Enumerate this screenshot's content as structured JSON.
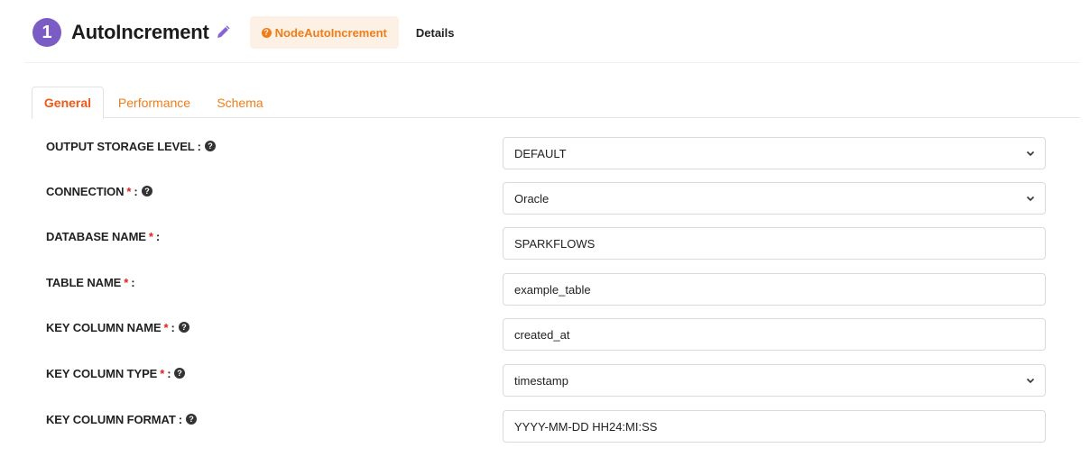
{
  "header": {
    "step_number": "1",
    "title": "AutoIncrement",
    "node_type": "NodeAutoIncrement",
    "details_label": "Details"
  },
  "tabs": [
    {
      "label": "General",
      "active": true
    },
    {
      "label": "Performance",
      "active": false
    },
    {
      "label": "Schema",
      "active": false
    }
  ],
  "fields": {
    "output_storage_level": {
      "label": "OUTPUT STORAGE LEVEL",
      "required": false,
      "help": true,
      "type": "select",
      "value": "DEFAULT"
    },
    "connection": {
      "label": "CONNECTION",
      "required": true,
      "help": true,
      "type": "select",
      "value": "Oracle"
    },
    "database_name": {
      "label": "DATABASE NAME",
      "required": true,
      "help": false,
      "type": "text",
      "value": "SPARKFLOWS"
    },
    "table_name": {
      "label": "TABLE NAME",
      "required": true,
      "help": false,
      "type": "text",
      "value": "example_table"
    },
    "key_column_name": {
      "label": "KEY COLUMN NAME",
      "required": true,
      "help": true,
      "type": "text",
      "value": "created_at"
    },
    "key_column_type": {
      "label": "KEY COLUMN TYPE",
      "required": true,
      "help": true,
      "type": "select",
      "value": "timestamp"
    },
    "key_column_format": {
      "label": "KEY COLUMN FORMAT",
      "required": false,
      "help": true,
      "type": "text",
      "value": "YYYY-MM-DD HH24:MI:SS"
    }
  },
  "symbols": {
    "required_mark": "*",
    "colon": ":"
  },
  "icons": {
    "edit": "pencil-icon",
    "help": "question-circle-icon",
    "badge_help": "question-circle-icon",
    "dropdown": "chevron-down-icon"
  },
  "colors": {
    "step_badge": "#7b5cc4",
    "accent": "#ef7d1a",
    "active_tab": "#ef5a1a",
    "required": "#e02020",
    "badge_bg": "#fdf1e6"
  }
}
